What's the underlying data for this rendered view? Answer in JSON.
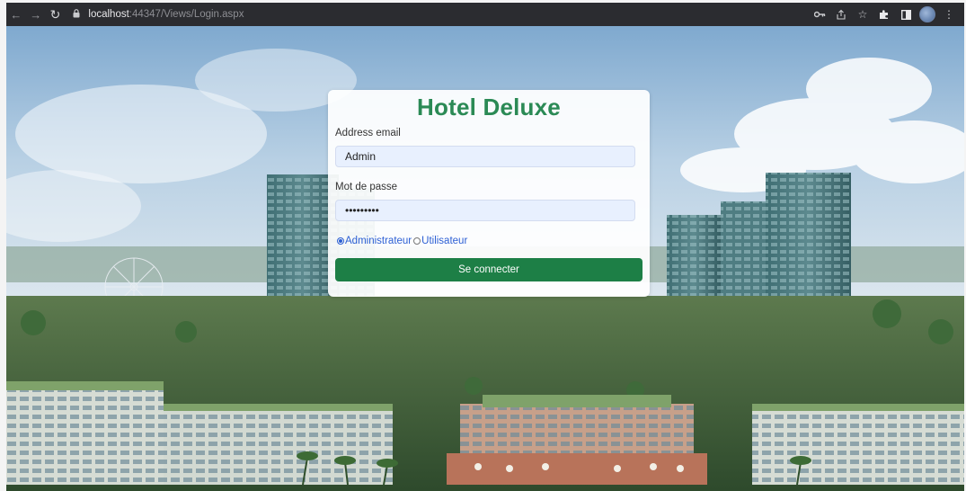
{
  "browser": {
    "url_host": "localhost",
    "url_rest": ":44347/Views/Login.aspx",
    "icons": [
      "back-icon",
      "forward-icon",
      "reload-icon",
      "lock-icon",
      "key-icon",
      "share-icon",
      "star-icon",
      "extensions-icon",
      "sidebar-icon",
      "profile-avatar",
      "more-icon"
    ]
  },
  "login": {
    "title": "Hotel Deluxe",
    "email_label": "Address email",
    "email_value": "Admin",
    "password_label": "Mot de passe",
    "password_value": "passwordx",
    "roles": [
      {
        "label": "Administrateur",
        "checked": true
      },
      {
        "label": "Utilisateur",
        "checked": false
      }
    ],
    "submit_label": "Se connecter"
  },
  "colors": {
    "title": "#2b8a55",
    "button": "#1d7f46",
    "input_bg": "#e8f0fe",
    "radio_text": "#2c5fd4",
    "chrome_bg": "#2b2c30"
  }
}
